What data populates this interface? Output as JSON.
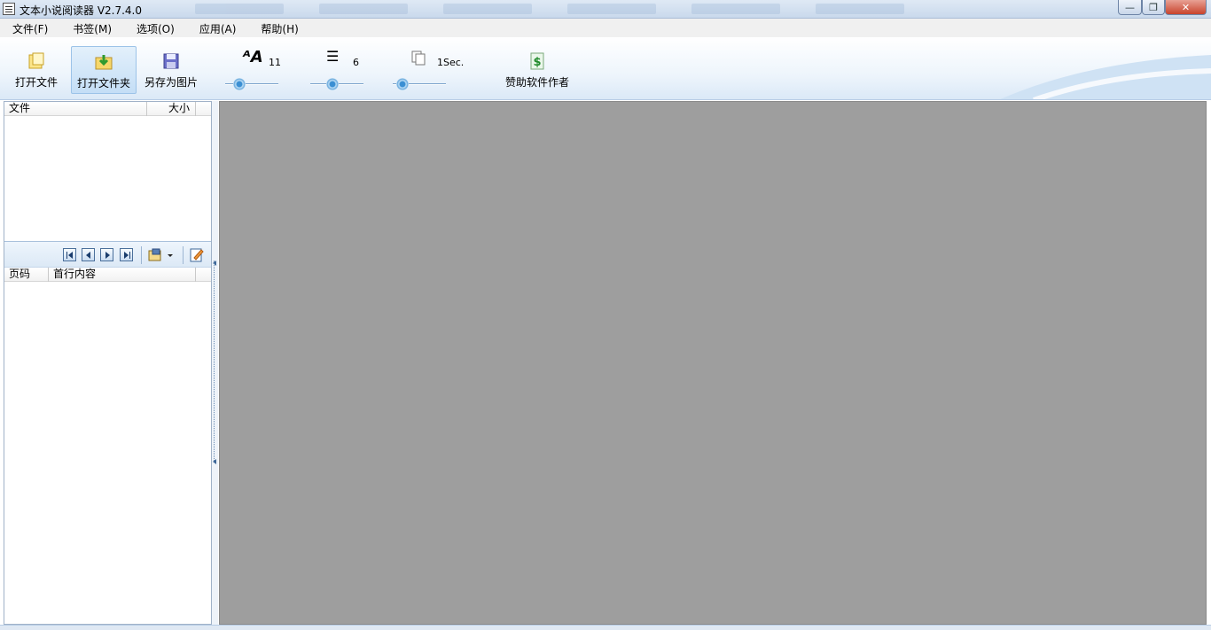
{
  "window": {
    "title": "文本小说阅读器 V2.7.4.0",
    "controls": {
      "minimize": "—",
      "maximize": "❐",
      "close": "✕"
    }
  },
  "menu": [
    "文件(F)",
    "书签(M)",
    "选项(O)",
    "应用(A)",
    "帮助(H)"
  ],
  "toolbar": {
    "open_file": "打开文件",
    "open_folder": "打开文件夹",
    "save_as_image": "另存为图片",
    "sponsor": "赞助软件作者",
    "font_size": {
      "icon": "font-size-icon",
      "value": "11",
      "level": 0.1
    },
    "line_spacing": {
      "icon": "line-spacing-icon",
      "value": "6",
      "level": 0.3
    },
    "page_interval": {
      "icon": "page-interval-icon",
      "value": "1Sec.",
      "level": 0.0
    }
  },
  "file_list": {
    "columns": [
      "文件",
      "大小"
    ]
  },
  "page_list": {
    "columns": [
      "页码",
      "首行内容"
    ]
  },
  "colors": {
    "reader_bg": "#9e9e9e",
    "accent": "#3b8fd3"
  }
}
